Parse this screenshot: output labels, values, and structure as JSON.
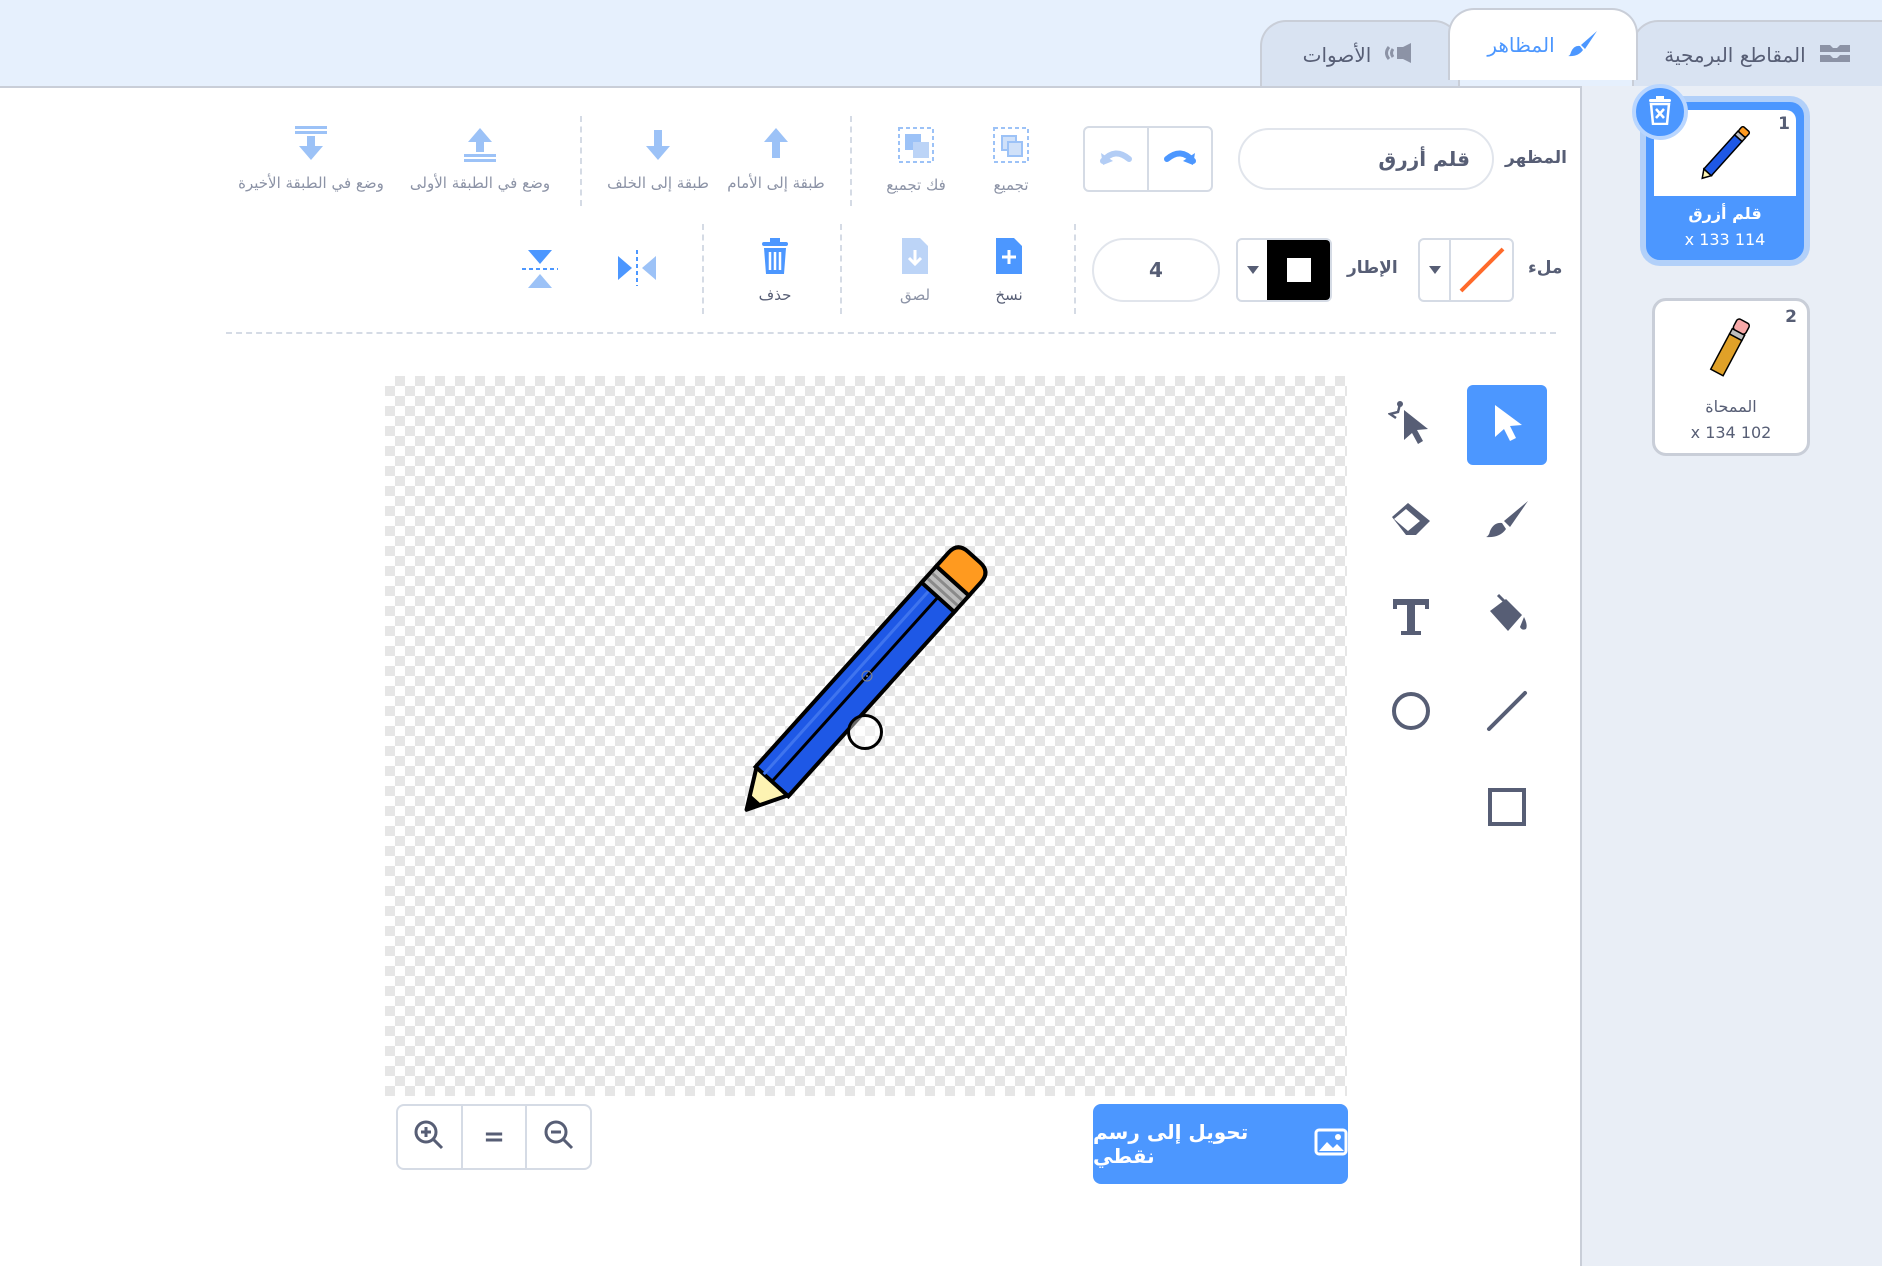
{
  "tabs": [
    {
      "label": "المقاطع البرمجية",
      "icon": "code-icon"
    },
    {
      "label": "المظاهر",
      "icon": "paintbrush-icon"
    },
    {
      "label": "الأصوات",
      "icon": "sound-icon"
    }
  ],
  "costume": {
    "label": "المظهر",
    "name_value": "قلم أزرق"
  },
  "arrange": {
    "group": "تجميع",
    "ungroup": "فك تجميع",
    "forward": "طبقة إلى الأمام",
    "backward": "طبقة إلى الخلف",
    "front": "وضع في الطبقة الأولى",
    "back": "وضع في الطبقة الأخيرة"
  },
  "style": {
    "fill_label": "ملء",
    "outline_label": "الإطار",
    "outline_width": "4",
    "fill_color": "#ff6a2a",
    "outline_color": "#000000"
  },
  "edit": {
    "copy": "نسخ",
    "paste": "لصق",
    "delete": "حذف"
  },
  "canvas": {
    "convert_button": "تحويل إلى رسم نقطي",
    "zoom_in": "zoom-in-icon",
    "zoom_reset": "=",
    "zoom_out": "zoom-out-icon"
  },
  "costumes": [
    {
      "number": "1",
      "name": "قلم أزرق",
      "size": "x 133 114",
      "selected": true
    },
    {
      "number": "2",
      "name": "الممحاة",
      "size": "x 134 102",
      "selected": false
    }
  ],
  "colors": {
    "accent": "#4c97ff",
    "text": "#575e75"
  }
}
